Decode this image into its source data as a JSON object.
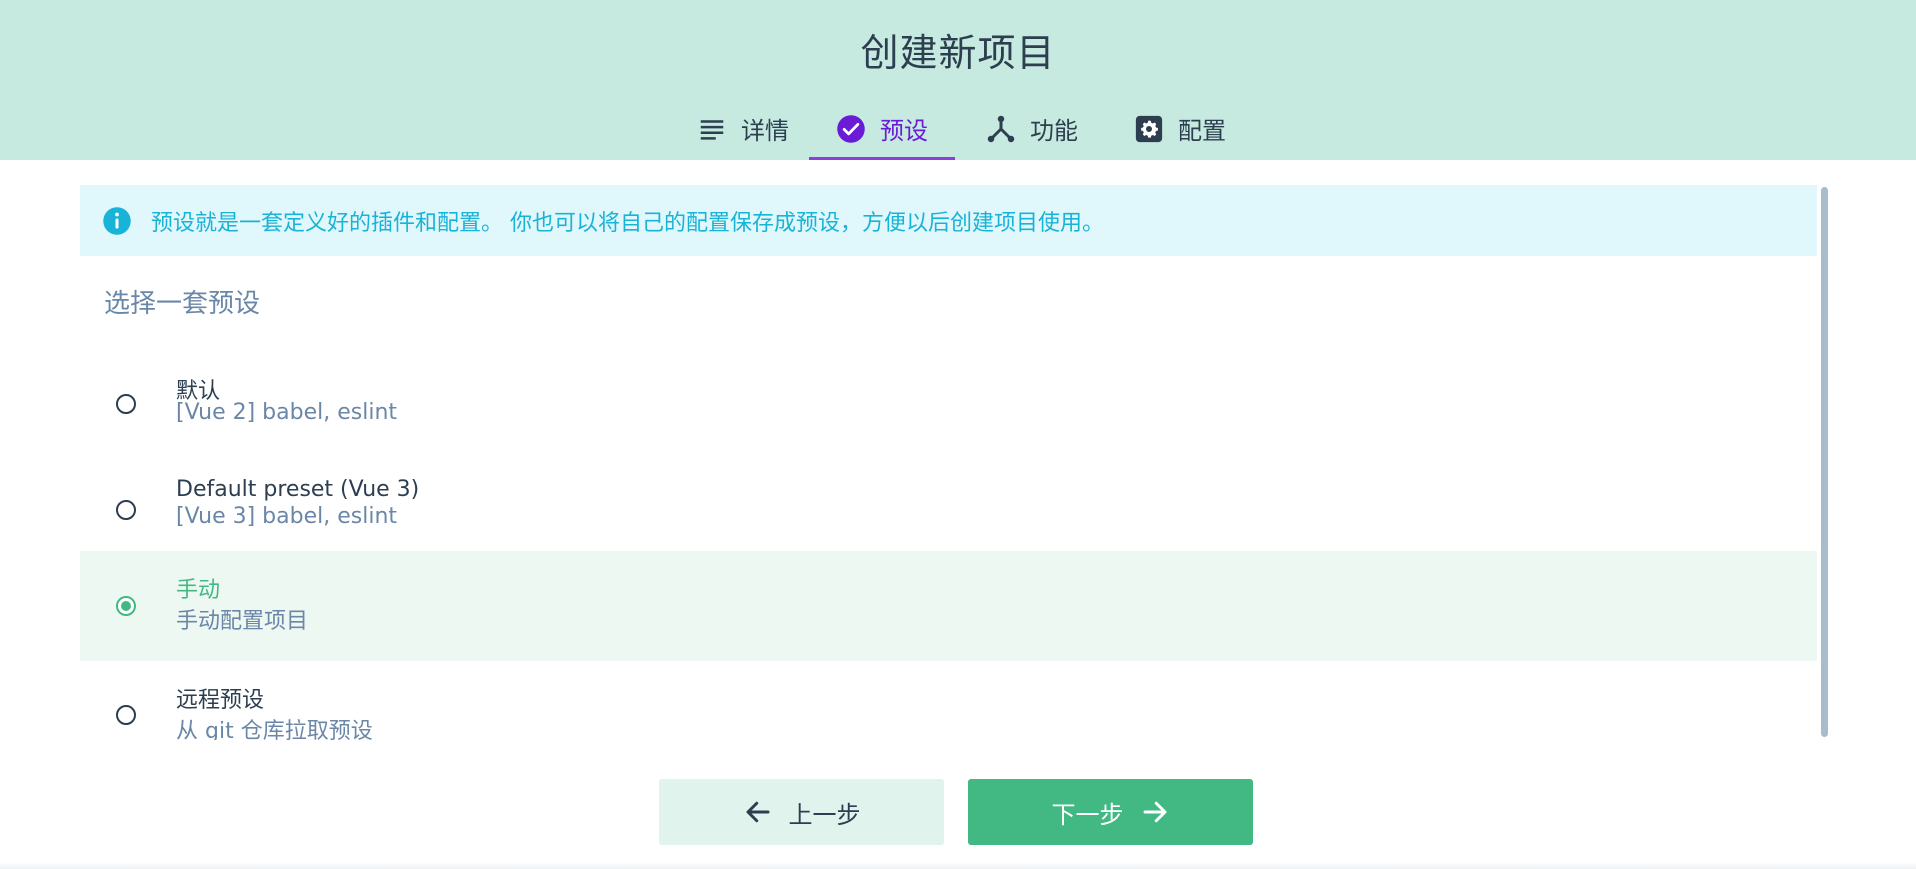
{
  "page": {
    "title": "创建新项目"
  },
  "tabs": [
    {
      "label": "详情",
      "icon": "list-icon",
      "active": false
    },
    {
      "label": "预设",
      "icon": "check-circle-icon",
      "active": true
    },
    {
      "label": "功能",
      "icon": "fork-icon",
      "active": false
    },
    {
      "label": "配置",
      "icon": "gear-icon",
      "active": false
    }
  ],
  "info": {
    "icon": "info-icon",
    "text": "预设就是一套定义好的插件和配置。 你也可以将自己的配置保存成预设，方便以后创建项目使用。"
  },
  "section": {
    "title": "选择一套预设"
  },
  "options": [
    {
      "name": "默认",
      "description": "[Vue 2] babel, eslint",
      "selected": false
    },
    {
      "name": "Default preset (Vue 3)",
      "description": "[Vue 3] babel, eslint",
      "selected": false
    },
    {
      "name": "手动",
      "description": "手动配置项目",
      "selected": true
    },
    {
      "name": "远程预设",
      "description": "从 git 仓库拉取预设",
      "selected": false
    }
  ],
  "buttons": {
    "prev": {
      "label": "上一步",
      "icon": "arrow-left-icon"
    },
    "next": {
      "label": "下一步",
      "icon": "arrow-right-icon"
    }
  },
  "colors": {
    "header_bg": "#c6eadf",
    "accent_purple": "#6a1bd6",
    "primary_green": "#42b983",
    "info_text": "#1ab3d8",
    "info_bg": "#e0f7fc",
    "text_dark": "#2c3e50",
    "text_muted": "#6b87a7"
  }
}
